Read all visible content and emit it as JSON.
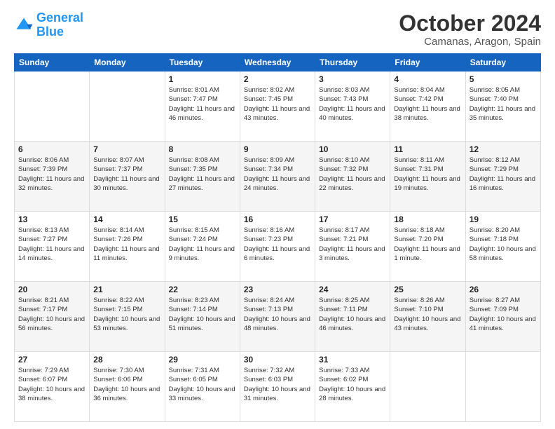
{
  "logo": {
    "line1": "General",
    "line2": "Blue"
  },
  "title": "October 2024",
  "location": "Camanas, Aragon, Spain",
  "days_header": [
    "Sunday",
    "Monday",
    "Tuesday",
    "Wednesday",
    "Thursday",
    "Friday",
    "Saturday"
  ],
  "weeks": [
    [
      {
        "day": "",
        "info": ""
      },
      {
        "day": "",
        "info": ""
      },
      {
        "day": "1",
        "info": "Sunrise: 8:01 AM\nSunset: 7:47 PM\nDaylight: 11 hours and 46 minutes."
      },
      {
        "day": "2",
        "info": "Sunrise: 8:02 AM\nSunset: 7:45 PM\nDaylight: 11 hours and 43 minutes."
      },
      {
        "day": "3",
        "info": "Sunrise: 8:03 AM\nSunset: 7:43 PM\nDaylight: 11 hours and 40 minutes."
      },
      {
        "day": "4",
        "info": "Sunrise: 8:04 AM\nSunset: 7:42 PM\nDaylight: 11 hours and 38 minutes."
      },
      {
        "day": "5",
        "info": "Sunrise: 8:05 AM\nSunset: 7:40 PM\nDaylight: 11 hours and 35 minutes."
      }
    ],
    [
      {
        "day": "6",
        "info": "Sunrise: 8:06 AM\nSunset: 7:39 PM\nDaylight: 11 hours and 32 minutes."
      },
      {
        "day": "7",
        "info": "Sunrise: 8:07 AM\nSunset: 7:37 PM\nDaylight: 11 hours and 30 minutes."
      },
      {
        "day": "8",
        "info": "Sunrise: 8:08 AM\nSunset: 7:35 PM\nDaylight: 11 hours and 27 minutes."
      },
      {
        "day": "9",
        "info": "Sunrise: 8:09 AM\nSunset: 7:34 PM\nDaylight: 11 hours and 24 minutes."
      },
      {
        "day": "10",
        "info": "Sunrise: 8:10 AM\nSunset: 7:32 PM\nDaylight: 11 hours and 22 minutes."
      },
      {
        "day": "11",
        "info": "Sunrise: 8:11 AM\nSunset: 7:31 PM\nDaylight: 11 hours and 19 minutes."
      },
      {
        "day": "12",
        "info": "Sunrise: 8:12 AM\nSunset: 7:29 PM\nDaylight: 11 hours and 16 minutes."
      }
    ],
    [
      {
        "day": "13",
        "info": "Sunrise: 8:13 AM\nSunset: 7:27 PM\nDaylight: 11 hours and 14 minutes."
      },
      {
        "day": "14",
        "info": "Sunrise: 8:14 AM\nSunset: 7:26 PM\nDaylight: 11 hours and 11 minutes."
      },
      {
        "day": "15",
        "info": "Sunrise: 8:15 AM\nSunset: 7:24 PM\nDaylight: 11 hours and 9 minutes."
      },
      {
        "day": "16",
        "info": "Sunrise: 8:16 AM\nSunset: 7:23 PM\nDaylight: 11 hours and 6 minutes."
      },
      {
        "day": "17",
        "info": "Sunrise: 8:17 AM\nSunset: 7:21 PM\nDaylight: 11 hours and 3 minutes."
      },
      {
        "day": "18",
        "info": "Sunrise: 8:18 AM\nSunset: 7:20 PM\nDaylight: 11 hours and 1 minute."
      },
      {
        "day": "19",
        "info": "Sunrise: 8:20 AM\nSunset: 7:18 PM\nDaylight: 10 hours and 58 minutes."
      }
    ],
    [
      {
        "day": "20",
        "info": "Sunrise: 8:21 AM\nSunset: 7:17 PM\nDaylight: 10 hours and 56 minutes."
      },
      {
        "day": "21",
        "info": "Sunrise: 8:22 AM\nSunset: 7:15 PM\nDaylight: 10 hours and 53 minutes."
      },
      {
        "day": "22",
        "info": "Sunrise: 8:23 AM\nSunset: 7:14 PM\nDaylight: 10 hours and 51 minutes."
      },
      {
        "day": "23",
        "info": "Sunrise: 8:24 AM\nSunset: 7:13 PM\nDaylight: 10 hours and 48 minutes."
      },
      {
        "day": "24",
        "info": "Sunrise: 8:25 AM\nSunset: 7:11 PM\nDaylight: 10 hours and 46 minutes."
      },
      {
        "day": "25",
        "info": "Sunrise: 8:26 AM\nSunset: 7:10 PM\nDaylight: 10 hours and 43 minutes."
      },
      {
        "day": "26",
        "info": "Sunrise: 8:27 AM\nSunset: 7:09 PM\nDaylight: 10 hours and 41 minutes."
      }
    ],
    [
      {
        "day": "27",
        "info": "Sunrise: 7:29 AM\nSunset: 6:07 PM\nDaylight: 10 hours and 38 minutes."
      },
      {
        "day": "28",
        "info": "Sunrise: 7:30 AM\nSunset: 6:06 PM\nDaylight: 10 hours and 36 minutes."
      },
      {
        "day": "29",
        "info": "Sunrise: 7:31 AM\nSunset: 6:05 PM\nDaylight: 10 hours and 33 minutes."
      },
      {
        "day": "30",
        "info": "Sunrise: 7:32 AM\nSunset: 6:03 PM\nDaylight: 10 hours and 31 minutes."
      },
      {
        "day": "31",
        "info": "Sunrise: 7:33 AM\nSunset: 6:02 PM\nDaylight: 10 hours and 28 minutes."
      },
      {
        "day": "",
        "info": ""
      },
      {
        "day": "",
        "info": ""
      }
    ]
  ]
}
